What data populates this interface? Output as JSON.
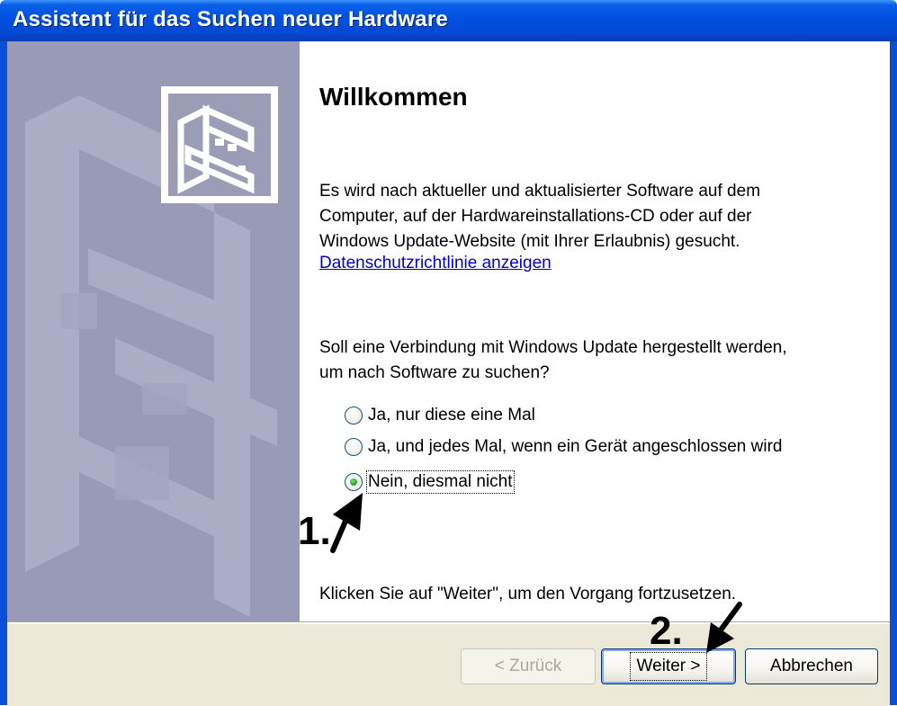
{
  "window": {
    "title": "Assistent für das Suchen neuer Hardware"
  },
  "content": {
    "heading": "Willkommen",
    "intro_lines": [
      "Es wird nach aktueller und aktualisierter Software auf dem",
      "Computer, auf der Hardwareinstallations-CD oder auf der",
      "Windows Update-Website (mit Ihrer Erlaubnis) gesucht."
    ],
    "privacy_link": "Datenschutzrichtlinie anzeigen",
    "question_lines": [
      "Soll eine Verbindung mit Windows Update hergestellt werden,",
      "um nach Software zu suchen?"
    ],
    "options": [
      {
        "label": "Ja, nur diese eine Mal",
        "checked": false
      },
      {
        "label": "Ja, und jedes Mal, wenn ein Gerät angeschlossen wird",
        "checked": false
      },
      {
        "label": "Nein, diesmal nicht",
        "checked": true
      }
    ],
    "continue_hint": "Klicken Sie auf \"Weiter\", um den Vorgang fortzusetzen."
  },
  "buttons": {
    "back": "< Zurück",
    "next": "Weiter >",
    "cancel": "Abbrechen"
  },
  "annotations": {
    "step1": "1.",
    "step2": "2."
  },
  "icons": {
    "sidebar_icon": "hardware-card-icon",
    "arrow_icon": "annotation-arrow-icon"
  },
  "colors": {
    "titlebar": "#0050e0",
    "sidebar": "#999ab6",
    "footer": "#ece9d8",
    "link": "#0000cc",
    "radio_checked": "#2ea62a"
  }
}
